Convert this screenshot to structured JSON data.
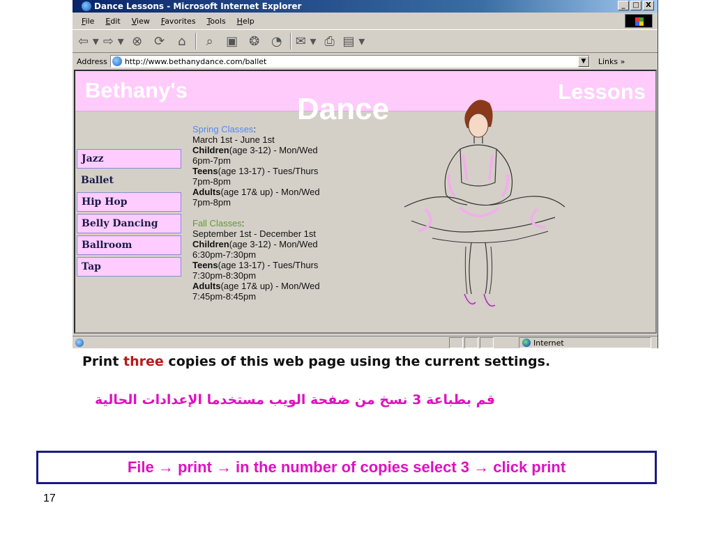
{
  "window": {
    "title": "Dance Lessons - Microsoft Internet Explorer",
    "controls": [
      "_",
      "□",
      "X"
    ]
  },
  "menu": [
    "File",
    "Edit",
    "View",
    "Favorites",
    "Tools",
    "Help"
  ],
  "toolbar": {
    "icons": [
      "back-icon",
      "forward-icon",
      "stop-icon",
      "refresh-icon",
      "home-icon",
      "search-icon",
      "favorites-icon",
      "media-icon",
      "history-icon",
      "mail-icon",
      "print-icon",
      "edit-icon"
    ]
  },
  "address": {
    "label": "Address",
    "url": "http://www.bethanydance.com/ballet",
    "links_label": "Links »"
  },
  "page": {
    "banner_left": "Bethany's",
    "banner_middle": "Dance",
    "banner_right": "Lessons",
    "nav": [
      {
        "label": "Jazz",
        "boxed": true
      },
      {
        "label": "Ballet",
        "boxed": false
      },
      {
        "label": "Hip Hop",
        "boxed": true
      },
      {
        "label": "Belly Dancing",
        "boxed": true
      },
      {
        "label": "Ballroom",
        "boxed": true
      },
      {
        "label": "Tap",
        "boxed": true
      }
    ],
    "spring": {
      "heading": "Spring Classes",
      "dates": "March 1st - June 1st",
      "classes": [
        {
          "group": "Children",
          "detail": "(age 3-12) - Mon/Wed",
          "time": "6pm-7pm"
        },
        {
          "group": "Teens",
          "detail": "(age 13-17) - Tues/Thurs",
          "time": "7pm-8pm"
        },
        {
          "group": "Adults",
          "detail": "(age 17& up) - Mon/Wed",
          "time": "7pm-8pm"
        }
      ]
    },
    "fall": {
      "heading": "Fall Classes",
      "dates": "September 1st - December 1st",
      "classes": [
        {
          "group": "Children",
          "detail": "(age 3-12) - Mon/Wed",
          "time": "6:30pm-7:30pm"
        },
        {
          "group": "Teens",
          "detail": "(age 13-17) - Tues/Thurs",
          "time": "7:30pm-8:30pm"
        },
        {
          "group": "Adults",
          "detail": "(age 17& up) - Mon/Wed",
          "time": "7:45pm-8:45pm"
        }
      ]
    }
  },
  "status": {
    "zone": "Internet"
  },
  "slide": {
    "instruction_before": "Print ",
    "instruction_highlight": "three",
    "instruction_after": " copies of this web page using the current settings.",
    "arabic": "قم بطباعة 3 نسخ من صفحة الويب مستخدما الإعدادات الحالية",
    "answer": "File → print → in the number of copies select 3 → click print",
    "page_number": "17"
  },
  "colors": {
    "banner": "#ffcbfb",
    "spring_heading": "#5588ee",
    "fall_heading": "#669933",
    "highlight": "#b81a1a",
    "magenta_text": "#e010c0",
    "answer_border": "#1a1a80"
  }
}
